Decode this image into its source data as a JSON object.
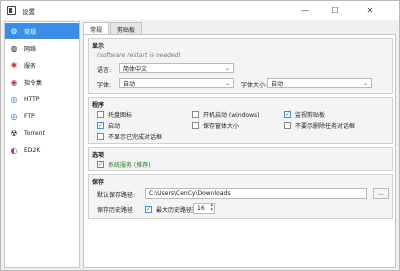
{
  "window": {
    "title": "设置",
    "minimize": "—",
    "maximize": "☐",
    "close": "✕"
  },
  "sidebar": {
    "items": [
      {
        "label": "常规",
        "icon": "gear-icon",
        "glyph": "⚙"
      },
      {
        "label": "网络",
        "icon": "globe-icon",
        "glyph": "◍"
      },
      {
        "label": "服务",
        "icon": "service-icon",
        "glyph": "✱"
      },
      {
        "label": "指令集",
        "icon": "instruction-icon",
        "glyph": "◉"
      },
      {
        "label": "HTTP",
        "icon": "http-icon",
        "glyph": "◎"
      },
      {
        "label": "FTP",
        "icon": "ftp-icon",
        "glyph": "◎"
      },
      {
        "label": "Torrent",
        "icon": "torrent-icon",
        "glyph": "☢"
      },
      {
        "label": "ED2K",
        "icon": "ed2k-icon",
        "glyph": "◐"
      }
    ]
  },
  "tabs": [
    {
      "label": "常规"
    },
    {
      "label": "剪贴板"
    }
  ],
  "display": {
    "title": "显示",
    "restart_note": "(software restart is needed)",
    "language_label": "语言:",
    "language_value": "简体中文",
    "font_label": "字体:",
    "font_value": "自动",
    "font_size_label": "字体大小:",
    "font_size_value": "自动"
  },
  "program": {
    "title": "程序",
    "options": [
      {
        "label": "托盘图标",
        "checked": false
      },
      {
        "label": "开机启动 (windows)",
        "checked": false
      },
      {
        "label": "监视剪贴板",
        "checked": true
      },
      {
        "label": "启动",
        "checked": true
      },
      {
        "label": "保存窗体大小",
        "checked": false
      },
      {
        "label": "不要示删除任务对话框",
        "checked": false
      },
      {
        "label": "不显示已完成对话框",
        "checked": false
      }
    ]
  },
  "options_group": {
    "title": "选项",
    "system_service_label": "系统服务 (推荐)",
    "system_service_checked": true
  },
  "save": {
    "title": "保存",
    "default_path_label": "默认保存路径:",
    "default_path_value": "C:\\Users\\CenCy\\Downloads",
    "browse_label": "...",
    "history_label": "保存历史路径",
    "history_checked": true,
    "max_history_label": "最大历史路径数量",
    "max_history_value": "16",
    "spin_up": "▴",
    "spin_down": "▾"
  },
  "colors": {
    "accent": "#3a8ee6",
    "check": "#2a7d2a"
  }
}
